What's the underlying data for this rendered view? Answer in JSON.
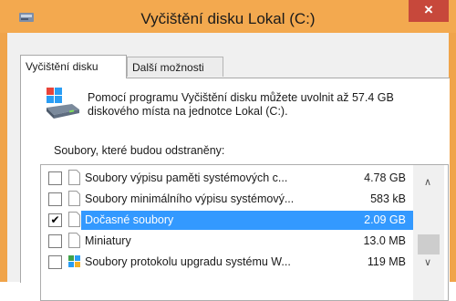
{
  "window": {
    "title": "Vyčištění disku Lokal (C:)",
    "close_glyph": "×",
    "icon": "disk-cleanup-icon",
    "accent_color": "#f3a94f",
    "close_color": "#c7483b"
  },
  "tabs": [
    {
      "label": "Vyčištění disku",
      "active": true
    },
    {
      "label": "Další možnosti",
      "active": false
    }
  ],
  "description": "Pomocí programu Vyčištění disku můžete uvolnit až 57.4 GB diskového místa na jednotce Lokal (C:).",
  "list": {
    "label": "Soubory, které budou odstraněny:",
    "selection_color": "#3399ff",
    "items": [
      {
        "name": "Soubory výpisu paměti systémových c...",
        "size": "4.78 GB",
        "checked": false,
        "selected": false,
        "icon": "file-icon"
      },
      {
        "name": "Soubory minimálního výpisu systémový...",
        "size": "583 kB",
        "checked": false,
        "selected": false,
        "icon": "file-icon"
      },
      {
        "name": "Dočasné soubory",
        "size": "2.09 GB",
        "checked": true,
        "selected": true,
        "icon": "file-icon"
      },
      {
        "name": "Miniatury",
        "size": "13.0 MB",
        "checked": false,
        "selected": false,
        "icon": "file-icon"
      },
      {
        "name": "Soubory protokolu upgradu systému W...",
        "size": "119 MB",
        "checked": false,
        "selected": false,
        "icon": "windows-log-icon"
      }
    ],
    "check_glyph": "✔",
    "scroll_up_glyph": "∧",
    "scroll_down_glyph": "∨"
  }
}
